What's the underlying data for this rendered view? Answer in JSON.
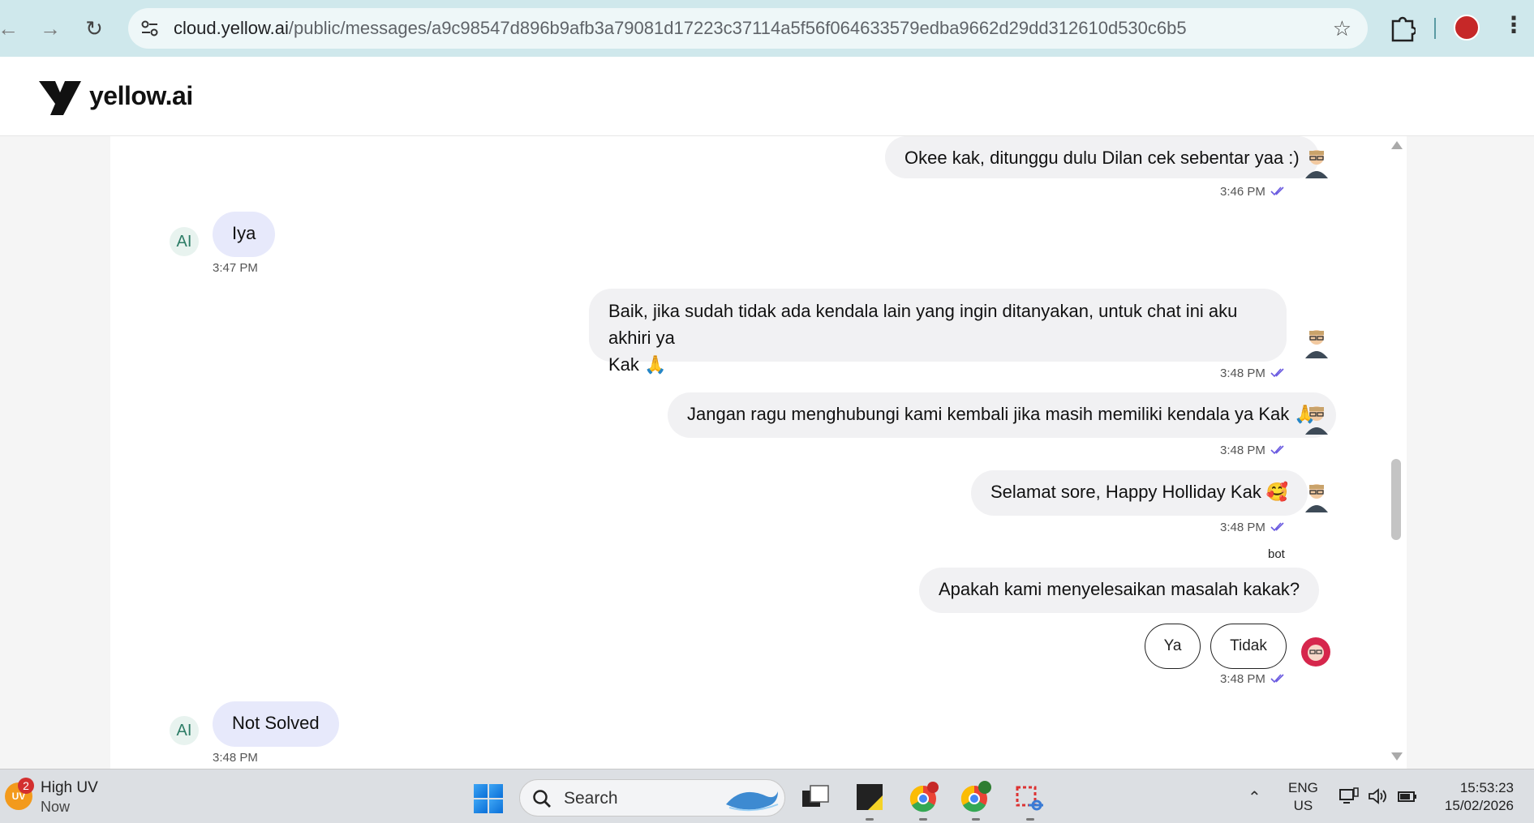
{
  "browser": {
    "url_host": "cloud.yellow.ai",
    "url_path": "/public/messages/a9c98547d896b9afb3a79081d17223c37114a5f56f064633579edba9662d29dd312610d530c6b5"
  },
  "app": {
    "logo_text": "yellow.ai"
  },
  "messages": [
    {
      "text": "Okee kak, ditunggu dulu Dilan cek sebentar yaa :)",
      "time": "3:46 PM"
    },
    {
      "text": "Iya",
      "time": "3:47 PM",
      "avatar": "AI"
    },
    {
      "text_line1": "Baik, jika sudah tidak ada kendala lain yang ingin ditanyakan, untuk chat ini aku akhiri ya",
      "text_line2": "Kak 🙏",
      "time": "3:48 PM"
    },
    {
      "text": "Jangan ragu menghubungi kami kembali jika masih memiliki kendala ya Kak 🙏",
      "time": "3:48 PM"
    },
    {
      "text": "Selamat sore, Happy Holliday Kak 🥰",
      "time": "3:48 PM"
    },
    {
      "sender_label": "bot",
      "text": "Apakah kami menyelesaikan masalah kakak?",
      "buttons": [
        "Ya",
        "Tidak"
      ],
      "time": "3:48 PM"
    },
    {
      "text": "Not Solved",
      "time": "3:48 PM",
      "avatar": "AI"
    }
  ],
  "taskbar": {
    "weather_badge": "2",
    "weather_icon_text": "UV",
    "weather_title": "High UV",
    "weather_sub": "Now",
    "search_placeholder": "Search",
    "lang_line1": "ENG",
    "lang_line2": "US",
    "time": "15:53:23",
    "date": "15/02/2026"
  },
  "colors": {
    "browser_bar": "#cfe8ec",
    "incoming_bubble": "#e7e9fb",
    "outgoing_bubble": "#f1f1f3",
    "tick": "#6a5ae0"
  }
}
